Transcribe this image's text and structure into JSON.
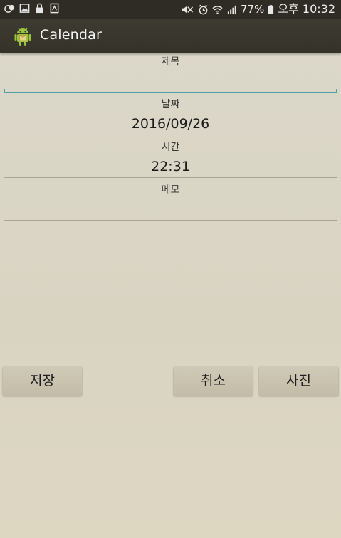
{
  "status_bar": {
    "battery": "77%",
    "time": "오후 10:32",
    "icons": [
      "face-icon",
      "image-icon",
      "lock-icon",
      "document-icon",
      "mute-icon",
      "alarm-icon",
      "wifi-icon",
      "signal-icon",
      "battery-icon"
    ]
  },
  "action_bar": {
    "title": "Calendar",
    "icon": "android-app-icon"
  },
  "form": {
    "title_label": "제목",
    "title_value": "",
    "date_label": "날짜",
    "date_value": "2016/09/26",
    "time_label": "시간",
    "time_value": "22:31",
    "memo_label": "메모",
    "memo_value": ""
  },
  "buttons": {
    "save": "저장",
    "cancel": "취소",
    "photo": "사진"
  },
  "colors": {
    "accent": "#4fa3a6",
    "action_bar": "#3b382f",
    "background": "#dad6c6"
  }
}
